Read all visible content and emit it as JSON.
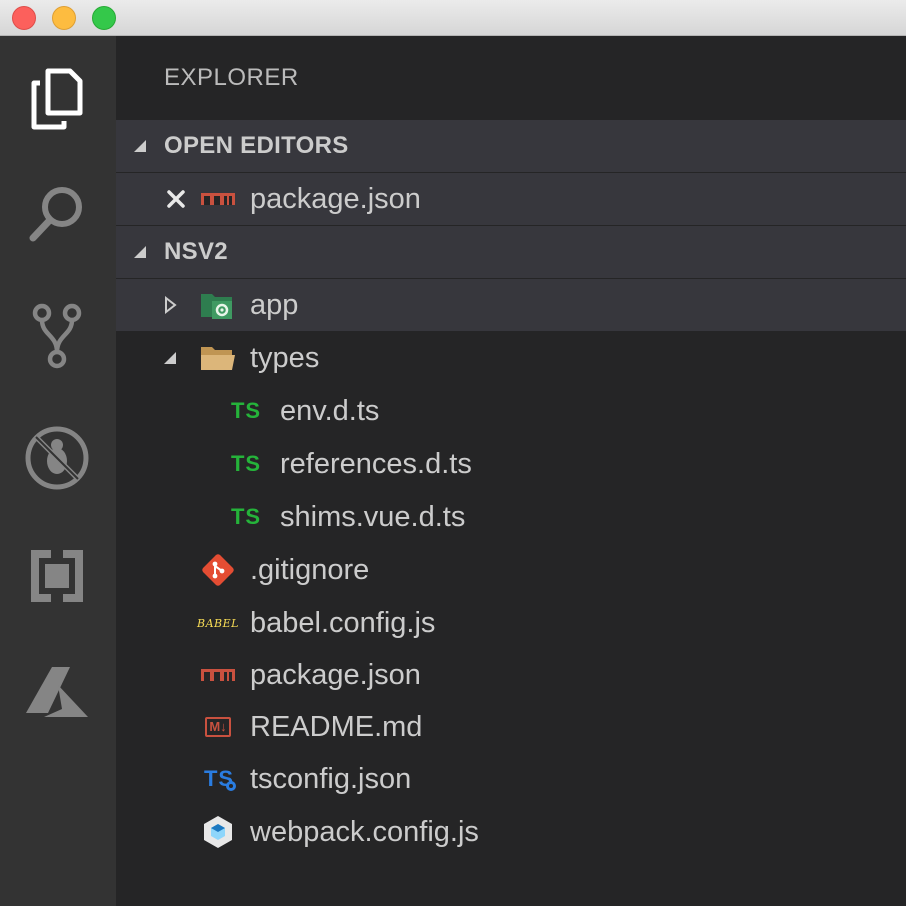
{
  "explorer": {
    "title": "EXPLORER"
  },
  "open_editors": {
    "header": "OPEN EDITORS",
    "items": [
      {
        "label": "package.json",
        "icon": "npm-icon"
      }
    ]
  },
  "project": {
    "header": "NSV2",
    "items": [
      {
        "label": "app",
        "icon": "folder-app-icon"
      },
      {
        "label": "types",
        "icon": "folder-open-icon"
      },
      {
        "label": "env.d.ts",
        "icon": "typescript-icon",
        "badge": "TS"
      },
      {
        "label": "references.d.ts",
        "icon": "typescript-icon",
        "badge": "TS"
      },
      {
        "label": "shims.vue.d.ts",
        "icon": "typescript-icon",
        "badge": "TS"
      },
      {
        "label": ".gitignore",
        "icon": "git-icon"
      },
      {
        "label": "babel.config.js",
        "icon": "babel-icon",
        "badge": "BABEL"
      },
      {
        "label": "package.json",
        "icon": "npm-icon"
      },
      {
        "label": "README.md",
        "icon": "markdown-icon",
        "badge": "M↓"
      },
      {
        "label": "tsconfig.json",
        "icon": "tsconfig-icon",
        "badge": "TS"
      },
      {
        "label": "webpack.config.js",
        "icon": "webpack-icon"
      }
    ]
  },
  "colors": {
    "activity_bar": "#333333",
    "sidebar": "#252526",
    "highlight": "#37373d",
    "typescript": "#25b33a",
    "npm": "#c9513f",
    "git": "#e44d33",
    "babel": "#f5da55"
  }
}
